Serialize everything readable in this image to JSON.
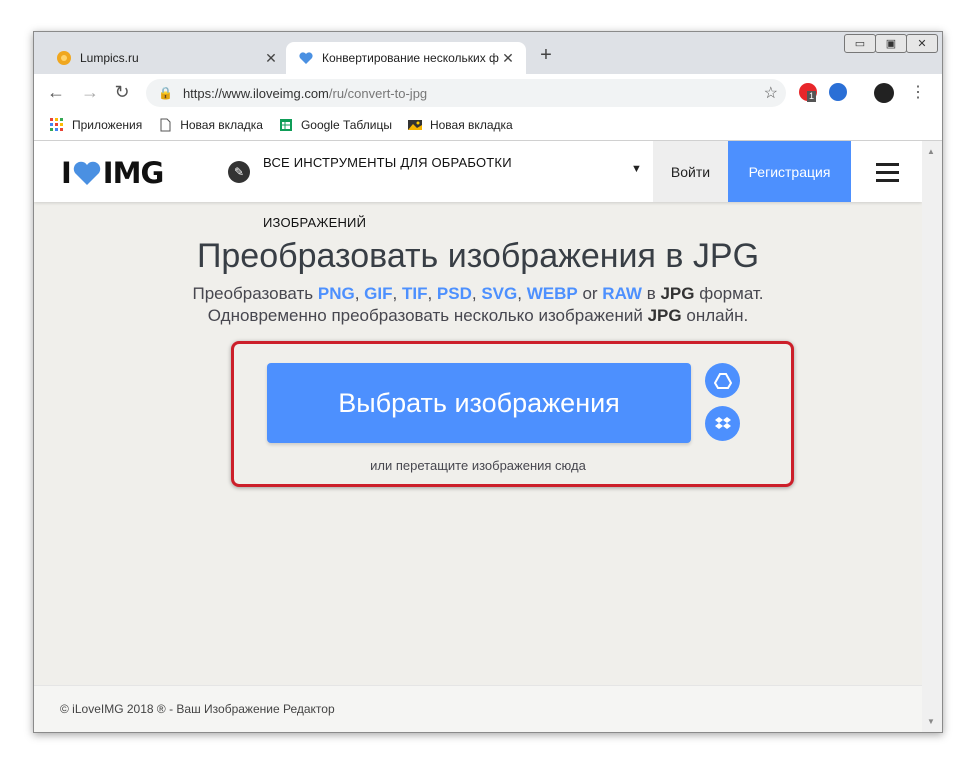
{
  "window": {
    "controls": [
      "▭",
      "▣",
      "✕"
    ]
  },
  "tabs": [
    {
      "title": "Lumpics.ru",
      "close": "✕"
    },
    {
      "title": "Конвертирование нескольких ф",
      "close": "✕"
    }
  ],
  "new_tab": "+",
  "toolbar": {
    "back": "←",
    "forward": "→",
    "reload": "↻",
    "url_host": "https://www.iloveimg.com",
    "url_path": "/ru/convert-to-jpg",
    "star": "☆",
    "extension_badge": "1",
    "menu": "⋮"
  },
  "bookmarks": [
    {
      "label": "Приложения",
      "icon": "apps-grid-icon"
    },
    {
      "label": "Новая вкладка",
      "icon": "page-icon"
    },
    {
      "label": "Google Таблицы",
      "icon": "sheets-icon"
    },
    {
      "label": "Новая вкладка",
      "icon": "image-icon"
    }
  ],
  "site": {
    "logo_left": "I",
    "logo_right": "IMG",
    "tools_menu": "ВСЕ ИНСТРУМЕНТЫ ДЛЯ ОБРАБОТКИ ИЗОБРАЖЕНИЙ",
    "caret": "▼",
    "login": "Войти",
    "register": "Регистрация"
  },
  "main": {
    "title": "Преобразовать изображения в JPG",
    "sub1": {
      "prefix": "Преобразовать",
      "formats": [
        "PNG",
        "GIF",
        "TIF",
        "PSD",
        "SVG",
        "WEBP"
      ],
      "or": "or",
      "last": "RAW",
      "in": "в",
      "target": "JPG",
      "suffix": "формат."
    },
    "sub2": {
      "prefix": "Одновременно преобразовать несколько изображений",
      "target": "JPG",
      "suffix": "онлайн."
    },
    "select_button": "Выбрать изображения",
    "drag_hint": "или перетащите изображения сюда"
  },
  "footer": {
    "text": "© iLoveIMG 2018 ® - Ваш Изображение Редактор"
  },
  "colors": {
    "accent": "#4d90fe",
    "highlight": "#cc1f2a",
    "page_bg": "#f0efeb"
  }
}
